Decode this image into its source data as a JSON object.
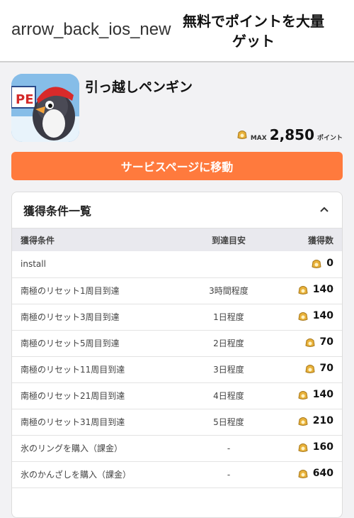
{
  "header": {
    "back_icon_text": "arrow_back_ios_new",
    "title": "無料でポイントを大量ゲット"
  },
  "app": {
    "name": "引っ越しペンギン",
    "max_label": "MAX",
    "max_points": "2,850",
    "points_unit": "ポイント"
  },
  "cta": {
    "label": "サービスページに移動"
  },
  "conditions": {
    "title": "獲得条件一覧",
    "columns": [
      "獲得条件",
      "到達目安",
      "獲得数"
    ],
    "rows": [
      {
        "condition": "install",
        "target": "",
        "points": "0"
      },
      {
        "condition": "南極のリセット1周目到達",
        "target": "3時間程度",
        "points": "140"
      },
      {
        "condition": "南極のリセット3周目到達",
        "target": "1日程度",
        "points": "140"
      },
      {
        "condition": "南極のリセット5周目到達",
        "target": "2日程度",
        "points": "70"
      },
      {
        "condition": "南極のリセット11周目到達",
        "target": "3日程度",
        "points": "70"
      },
      {
        "condition": "南極のリセット21周目到達",
        "target": "4日程度",
        "points": "140"
      },
      {
        "condition": "南極のリセット31周目到達",
        "target": "5日程度",
        "points": "210"
      },
      {
        "condition": "氷のリングを購入（課金）",
        "target": "-",
        "points": "160"
      },
      {
        "condition": "氷のかんざしを購入（課金）",
        "target": "-",
        "points": "640"
      }
    ]
  },
  "colors": {
    "accent": "#ff7a3d",
    "coin": "#e8b13a"
  }
}
